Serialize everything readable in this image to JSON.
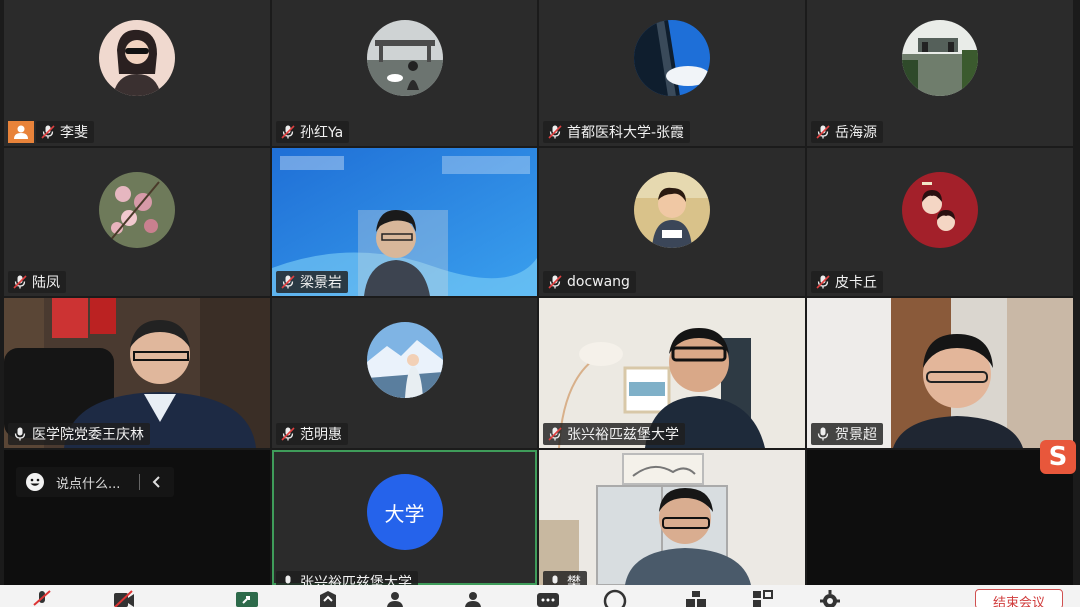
{
  "participants": [
    {
      "name": "李斐",
      "host": true
    },
    {
      "name": "孙红Ya"
    },
    {
      "name": "首都医科大学-张霞"
    },
    {
      "name": "岳海源"
    },
    {
      "name": "陆凤"
    },
    {
      "name": "梁景岩"
    },
    {
      "name": "docwang"
    },
    {
      "name": "皮卡丘"
    },
    {
      "name": "医学院党委王庆林"
    },
    {
      "name": "范明惠"
    },
    {
      "name": "张兴裕匹兹堡大学"
    },
    {
      "name": "贺景超"
    },
    {
      "name": "张兴裕匹兹堡大学",
      "avatar_text": "大学"
    },
    {
      "name": "樊"
    }
  ],
  "chat": {
    "placeholder": "说点什么..."
  },
  "toolbar": {
    "leave_label": "结束会议"
  },
  "colors": {
    "host_badge": "#e8833a",
    "avatar_blue": "#2563eb",
    "active_border": "#3f9c5a",
    "leave": "#d03b3b"
  }
}
